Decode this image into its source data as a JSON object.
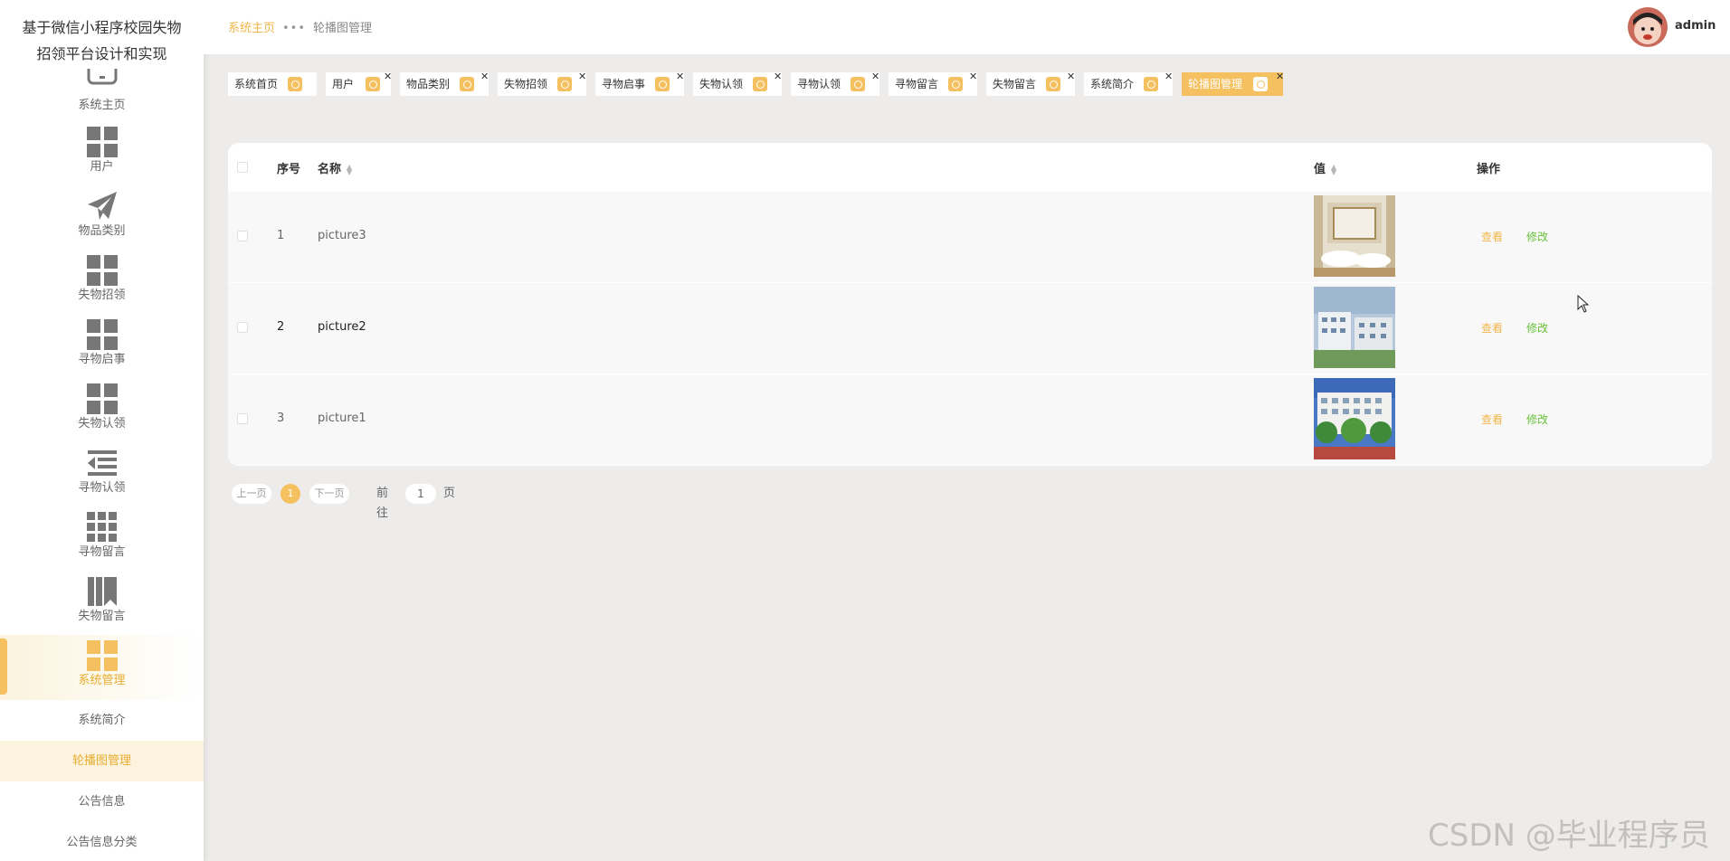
{
  "sidebar": {
    "title_line1": "基于微信小程序校园失物",
    "title_line2": "招领平台设计和实现",
    "items": [
      {
        "label": "系统主页",
        "icon": "home-icon"
      },
      {
        "label": "用户",
        "icon": "grid-icon"
      },
      {
        "label": "物品类别",
        "icon": "paper-plane-icon"
      },
      {
        "label": "失物招领",
        "icon": "grid-icon"
      },
      {
        "label": "寻物启事",
        "icon": "grid-icon"
      },
      {
        "label": "失物认领",
        "icon": "grid-icon"
      },
      {
        "label": "寻物认领",
        "icon": "indent-icon"
      },
      {
        "label": "寻物留言",
        "icon": "grid9-icon"
      },
      {
        "label": "失物留言",
        "icon": "book-icon"
      },
      {
        "label": "系统管理",
        "icon": "grid-icon"
      }
    ],
    "subitems": [
      {
        "label": "系统简介"
      },
      {
        "label": "轮播图管理"
      },
      {
        "label": "公告信息"
      },
      {
        "label": "公告信息分类"
      }
    ]
  },
  "header": {
    "breadcrumb_home": "系统主页",
    "breadcrumb_sep": "•••",
    "breadcrumb_current": "轮播图管理",
    "username": "admin"
  },
  "tags": [
    {
      "label": "系统首页"
    },
    {
      "label": "用户"
    },
    {
      "label": "物品类别"
    },
    {
      "label": "失物招领"
    },
    {
      "label": "寻物启事"
    },
    {
      "label": "失物认领"
    },
    {
      "label": "寻物认领"
    },
    {
      "label": "寻物留言"
    },
    {
      "label": "失物留言"
    },
    {
      "label": "系统简介"
    },
    {
      "label": "轮播图管理"
    }
  ],
  "table": {
    "headers": {
      "index": "序号",
      "name": "名称",
      "value": "值",
      "action": "操作"
    },
    "rows": [
      {
        "index": "1",
        "name": "picture3",
        "view": "查看",
        "edit": "修改"
      },
      {
        "index": "2",
        "name": "picture2",
        "view": "查看",
        "edit": "修改"
      },
      {
        "index": "3",
        "name": "picture1",
        "view": "查看",
        "edit": "修改"
      }
    ]
  },
  "pagination": {
    "prev": "上一页",
    "current": "1",
    "next": "下一页",
    "goto_prefix": "前往",
    "goto_value": "1",
    "goto_suffix": "页"
  },
  "watermark": "CSDN @毕业程序员",
  "colors": {
    "accent": "#f5c060",
    "accent_text": "#f0b64a",
    "edit_green": "#67c23a",
    "bg": "#edecea"
  }
}
